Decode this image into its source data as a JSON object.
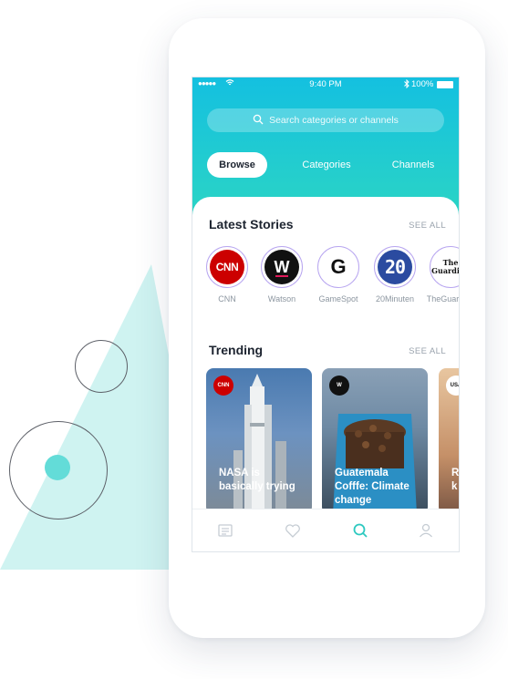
{
  "status_bar": {
    "signal": "●●●●●",
    "time": "9:40 PM",
    "battery": "100%"
  },
  "search": {
    "placeholder": "Search categories or channels"
  },
  "tabs": [
    {
      "label": "Browse",
      "active": true
    },
    {
      "label": "Categories",
      "active": false
    },
    {
      "label": "Channels",
      "active": false
    }
  ],
  "latest": {
    "title": "Latest Stories",
    "see_all": "SEE ALL",
    "channels": [
      {
        "name": "CNN",
        "logo_text": "CNN"
      },
      {
        "name": "Watson",
        "logo_text": "W"
      },
      {
        "name": "GameSpot",
        "logo_text": "G"
      },
      {
        "name": "20Minuten",
        "logo_text": "20"
      },
      {
        "name": "TheGuardian",
        "logo_text": "The Guardian"
      }
    ]
  },
  "trending": {
    "title": "Trending",
    "see_all": "SEE ALL",
    "cards": [
      {
        "badge": "CNN",
        "title": "NASA is basically trying"
      },
      {
        "badge": "W",
        "title": "Guatemala Cofffe: Climate change"
      },
      {
        "badge": "USA",
        "title": "R J k"
      }
    ]
  },
  "nav": [
    "news-icon",
    "heart-icon",
    "search-icon",
    "user-icon"
  ],
  "colors": {
    "accent": "#2fd8c0",
    "header_top": "#14c0e0",
    "triangle": "#cff3f1"
  }
}
